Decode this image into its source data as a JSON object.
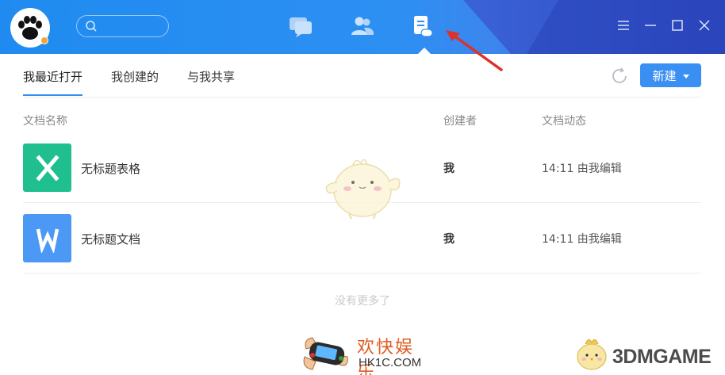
{
  "titlebar": {
    "icons": [
      "app-logo-icon",
      "search-icon",
      "chat-icon",
      "contacts-icon",
      "docs-icon",
      "menu-icon",
      "minimize-icon",
      "maximize-icon",
      "close-icon"
    ]
  },
  "tabs": [
    {
      "label": "我最近打开",
      "active": true
    },
    {
      "label": "我创建的",
      "active": false
    },
    {
      "label": "与我共享",
      "active": false
    }
  ],
  "toolbar": {
    "new_label": "新建"
  },
  "table": {
    "headers": {
      "name": "文档名称",
      "creator": "创建者",
      "activity": "文档动态"
    },
    "rows": [
      {
        "name": "无标题表格",
        "creator": "我",
        "activity": "14:11 由我编辑",
        "icon": "spreadsheet-icon",
        "color": "#1fbf8f"
      },
      {
        "name": "无标题文档",
        "creator": "我",
        "activity": "14:11 由我编辑",
        "icon": "document-icon",
        "color": "#4c98f5"
      }
    ]
  },
  "footer": {
    "no_more": "没有更多了"
  },
  "watermarks": {
    "left_cn": "欢快娱乐",
    "left_url": "HK1C.COM",
    "right_brand": "3DMGAME"
  },
  "colors": {
    "accent": "#3a8ff2",
    "titlebar": "#2d8ff2",
    "arrow": "#e0302a"
  }
}
